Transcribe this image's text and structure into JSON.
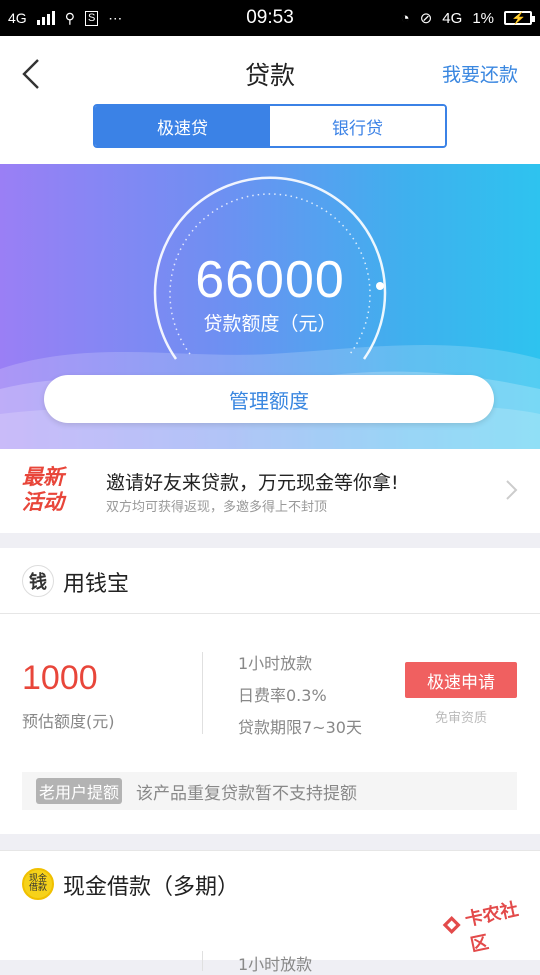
{
  "status_bar": {
    "network_left": "4G",
    "time": "09:53",
    "network_right": "4G",
    "battery_percent": "1%"
  },
  "header": {
    "title": "贷款",
    "action": "我要还款",
    "tabs": [
      {
        "label": "极速贷",
        "active": true
      },
      {
        "label": "银行贷",
        "active": false
      }
    ]
  },
  "hero": {
    "amount": "66000",
    "amount_label": "贷款额度（元）",
    "manage_button": "管理额度"
  },
  "promo": {
    "badge": "最新活动",
    "title": "邀请好友来贷款，万元现金等你拿!",
    "subtitle": "双方均可获得返现，多邀多得上不封顶"
  },
  "products": [
    {
      "name": "用钱宝",
      "logo_text": "钱",
      "estimate": "1000",
      "estimate_label": "预估额度(元)",
      "info": [
        "1小时放款",
        "日费率0.3%",
        "贷款期限7~30天"
      ],
      "apply_label": "极速申请",
      "exempt_label": "免审资质",
      "note_tag": "老用户提额",
      "note_text": "该产品重复贷款暂不支持提额"
    },
    {
      "name": "现金借款（多期）",
      "logo_text": "现金借款",
      "info_partial": "1小时放款"
    }
  ],
  "watermark": "卡农社区",
  "colors": {
    "accent": "#3b82e6",
    "brand_red": "#e8463a",
    "apply_red": "#f06060"
  }
}
